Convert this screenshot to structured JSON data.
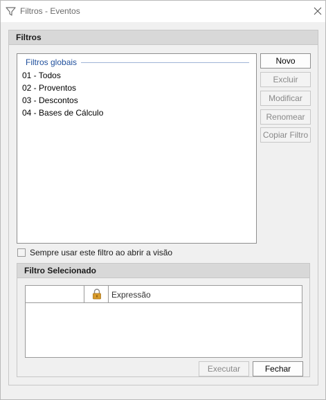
{
  "window": {
    "title": "Filtros - Eventos",
    "icon": "filter-icon",
    "close_icon": "close-icon"
  },
  "filtros": {
    "header": "Filtros",
    "list_header": "Filtros globais",
    "items": [
      "01 - Todos",
      "02 - Proventos",
      "03 - Descontos",
      "04 - Bases de Cálculo"
    ],
    "buttons": {
      "novo": "Novo",
      "excluir": "Excluir",
      "modificar": "Modificar",
      "renomear": "Renomear",
      "copiar": "Copiar Filtro"
    },
    "checkbox_label": "Sempre usar este filtro ao abrir a visão",
    "checkbox_checked": false
  },
  "filtro_selecionado": {
    "header": "Filtro Selecionado",
    "columns": [
      "",
      "",
      "Expressão"
    ],
    "lock_icon": "lock-icon",
    "rows": []
  },
  "footer": {
    "executar": "Executar",
    "fechar": "Fechar"
  },
  "colors": {
    "accent_text": "#1f4f9c",
    "lock_icon": "#d79a2b"
  }
}
